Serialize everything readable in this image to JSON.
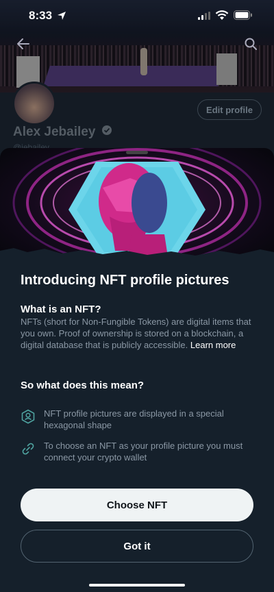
{
  "status_bar": {
    "time": "8:33"
  },
  "profile": {
    "name": "Alex Jebailey",
    "handle": "@jebailey",
    "edit_label": "Edit profile"
  },
  "sheet": {
    "title": "Introducing NFT profile pictures",
    "what_heading": "What is an NFT?",
    "what_body": "NFTs (short for Non-Fungible Tokens) are digital items that you own. Proof of ownership is stored on a blockchain, a digital database that is publicly accessible.",
    "learn_more": "Learn more",
    "meaning_heading": "So what does this mean?",
    "items": [
      {
        "icon": "hexagon-profile-icon",
        "text": "NFT profile pictures are displayed in a special hexagonal shape"
      },
      {
        "icon": "link-icon",
        "text": "To choose an NFT as your profile picture you must connect your crypto wallet"
      }
    ],
    "primary_button": "Choose NFT",
    "secondary_button": "Got it"
  },
  "colors": {
    "background": "#15202b",
    "primary_button_bg": "#eff3f4",
    "muted_text": "#8b98a5",
    "icon_teal": "#4fa3a0",
    "art_magenta": "#e0308c",
    "art_cyan": "#5fd0e8"
  }
}
